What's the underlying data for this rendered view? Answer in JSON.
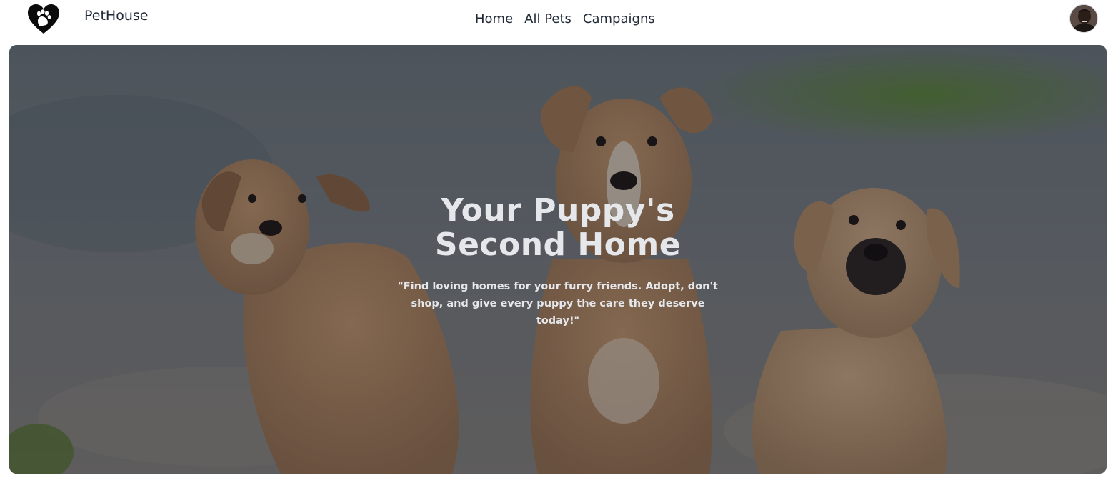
{
  "brand": {
    "name": "PetHouse",
    "logo_icon": "heart-paw-icon"
  },
  "nav": {
    "links": [
      "Home",
      "All Pets",
      "Campaigns"
    ]
  },
  "user": {
    "avatar_icon": "user-avatar-icon"
  },
  "hero": {
    "title_line1": "Your Puppy's",
    "title_line2": "Second Home",
    "subtitle": "\"Find loving homes for your furry friends. Adopt, don't shop, and give every puppy the care they deserve today!\"",
    "image": "three-puppies-photo"
  },
  "colors": {
    "text": "#1f2937",
    "hero_text": "#e5e7eb",
    "overlay": "#141820"
  }
}
